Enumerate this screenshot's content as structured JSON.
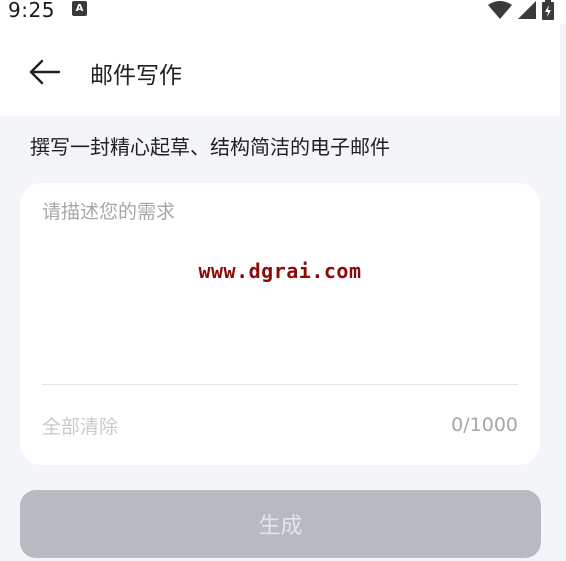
{
  "status_bar": {
    "time": "9:25",
    "notification_badge": "A"
  },
  "header": {
    "title": "邮件写作",
    "back_icon": "arrow-left-icon"
  },
  "subtitle": "撰写一封精心起草、结构简洁的电子邮件",
  "composer": {
    "value": "",
    "placeholder": "请描述您的需求",
    "watermark": "www.dgrai.com",
    "clear_label": "全部清除",
    "counter": "0/1000"
  },
  "actions": {
    "generate_label": "生成"
  },
  "colors": {
    "page_bg": "#f4f5f9",
    "card_bg": "#ffffff",
    "button_disabled": "#b8bac2",
    "watermark": "#8b0a0a"
  }
}
